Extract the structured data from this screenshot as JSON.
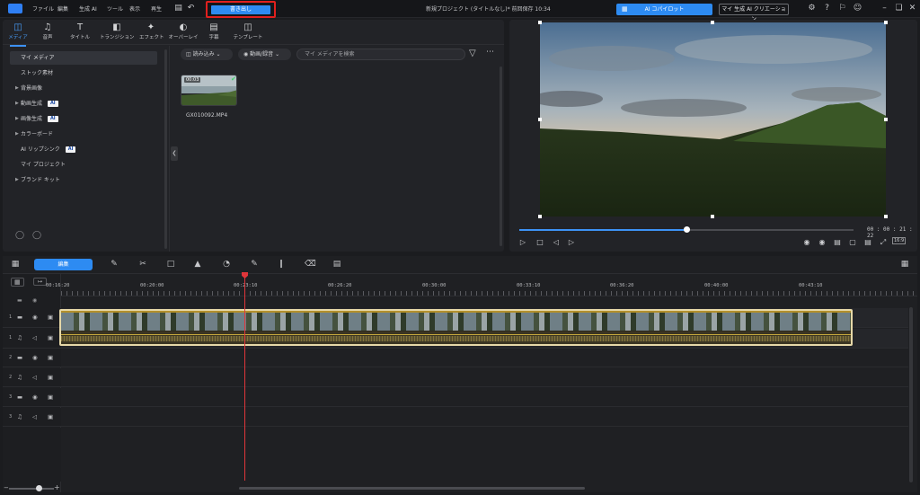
{
  "menubar": {
    "items": [
      "ファイル",
      "編集",
      "生成 AI",
      "ツール",
      "表示",
      "再生"
    ],
    "export_label": "書き出し",
    "project_title": "新規プロジェクト (タイトルなし)* 前回保存 10:34",
    "copilot_label": "AI コパイロット",
    "creation_label": "マイ 生成 AI クリエーション"
  },
  "media_tabs": [
    {
      "label": "メディア",
      "icon": "media-icon"
    },
    {
      "label": "音声",
      "icon": "music-note-icon"
    },
    {
      "label": "タイトル",
      "icon": "title-text-icon"
    },
    {
      "label": "トランジション",
      "icon": "transition-icon"
    },
    {
      "label": "エフェクト",
      "icon": "effect-icon"
    },
    {
      "label": "オーバーレイ",
      "icon": "overlay-icon"
    },
    {
      "label": "字幕",
      "icon": "subtitle-icon"
    },
    {
      "label": "テンプレート",
      "icon": "template-icon"
    }
  ],
  "sidebar": {
    "items": [
      {
        "label": "マイ メディア",
        "caret": false,
        "ai": false
      },
      {
        "label": "ストック素材",
        "caret": false,
        "ai": false
      },
      {
        "label": "背景画像",
        "caret": true,
        "ai": false
      },
      {
        "label": "動画生成",
        "caret": true,
        "ai": true
      },
      {
        "label": "画像生成",
        "caret": true,
        "ai": true
      },
      {
        "label": "カラーボード",
        "caret": true,
        "ai": false
      },
      {
        "label": "AI リップシンク",
        "caret": false,
        "ai": true
      },
      {
        "label": "マイ プロジェクト",
        "caret": false,
        "ai": false
      },
      {
        "label": "ブランド キット",
        "caret": true,
        "ai": false
      }
    ],
    "ai_badge": "AI"
  },
  "media_toolbar": {
    "import_label": "読み込み",
    "filter_label": "動画/録音",
    "search_placeholder": "マイ メディアを検索"
  },
  "media_item": {
    "duration": "00:03",
    "filename": "GX010092.MP4"
  },
  "preview": {
    "timecode": "00 : 00 : 21 : 22",
    "progress": 0.5,
    "aspect_label": "16:9"
  },
  "timeline": {
    "edit_label": "編集",
    "ruler_labels": [
      "00:16:20",
      "00:20:00",
      "00:23:10",
      "00:26:20",
      "00:30:00",
      "00:33:10",
      "00:36:20",
      "00:40:00",
      "00:43:10"
    ],
    "tracks": [
      {
        "num": "1",
        "type": "video"
      },
      {
        "num": "1",
        "type": "audio"
      },
      {
        "num": "2",
        "type": "video"
      },
      {
        "num": "2",
        "type": "audio"
      },
      {
        "num": "3",
        "type": "video"
      },
      {
        "num": "3",
        "type": "audio"
      }
    ]
  },
  "colors": {
    "accent": "#2d8bf2",
    "playhead": "#e0353a",
    "clip_border": "#e6d8a8",
    "export_highlight": "#e0201e"
  }
}
